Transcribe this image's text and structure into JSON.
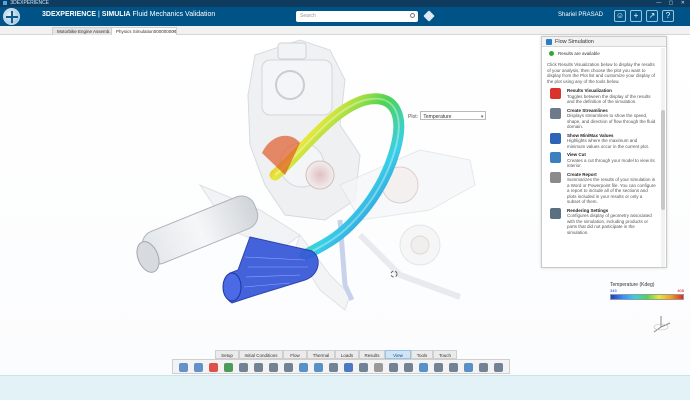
{
  "os_bar": {
    "title": "3DEXPERIENCE"
  },
  "header": {
    "brand": "3DEXPERIENCE",
    "separator": " | ",
    "app": "SIMULIA",
    "doc": " Fluid Mechanics Validation",
    "search_placeholder": "Search",
    "user_name": "Shariel PRASAD",
    "buttons": [
      "?",
      "+",
      "↗",
      "?"
    ]
  },
  "tabs": [
    {
      "label": "Motorbike Engine Assemb...",
      "active": false
    },
    {
      "label": "Physics Simulation000000004",
      "active": true
    }
  ],
  "viewport": {
    "plot_label": "Plot:",
    "plot_value": "Temperature"
  },
  "panel": {
    "title": "Flow Simulation",
    "status": "Results are available",
    "intro": "Click Results Visualization below to display the results of your analysis, then choose the plot you want to display from the Plot list and customize your display of the plot using any of the tools below.",
    "features": [
      {
        "title": "Results Visualization",
        "desc": "Toggles between the display of the results and the definition of the simulation.",
        "icon": "results-visualization-icon",
        "color": "#d9342b"
      },
      {
        "title": "Create Streamlines",
        "desc": "Displays streamlines to show the speed, shape, and direction of flow through the fluid domain.",
        "icon": "streamlines-icon",
        "color": "#6c7a89"
      },
      {
        "title": "Show Min/Max Values",
        "desc": "Highlights where the maximum and minimum values occur in the current plot.",
        "icon": "min-max-icon",
        "color": "#2d64b8"
      },
      {
        "title": "View Cut",
        "desc": "Creates a cut through your model to view its interior.",
        "icon": "view-cut-icon",
        "color": "#3b7fbf"
      },
      {
        "title": "Create Report",
        "desc": "Summarizes the results of your simulation in a Word or Powerpoint file. You can configure a report to include all of the sections and plots included in your results or only a subset of them.",
        "icon": "report-icon",
        "color": "#8a8a8a"
      },
      {
        "title": "Rendering Settings",
        "desc": "Configures display of geometry associated with the simulation, including products or parts that did not participate in the simulation.",
        "icon": "rendering-settings-icon",
        "color": "#5b6f82"
      }
    ]
  },
  "legend": {
    "title": "Temperature (Kdeg)",
    "min": "345",
    "max": "405",
    "colors": [
      "#1a3fcf",
      "#3b8cff",
      "#38d0e6",
      "#4fd44f",
      "#e8e83a",
      "#f29c2a",
      "#e42a1f"
    ]
  },
  "section_tabs": [
    "Setup",
    "Initial Conditions",
    "Flow",
    "Thermal",
    "Loads",
    "Results",
    "View",
    "Tools",
    "Touch"
  ],
  "active_section": "View",
  "toolbar": {
    "tools": [
      "undo-icon",
      "redo-icon",
      "compass-app-icon",
      "plot-icon",
      "zoom-icon",
      "fit-all-icon",
      "pan-icon",
      "rotate-icon",
      "look-at-icon",
      "normal-view-icon",
      "zoom-area-icon",
      "ground-icon",
      "shading-icon",
      "layers-icon",
      "multi-view-icon",
      "hide-show-icon",
      "cut-icon",
      "capture-icon",
      "measure-icon",
      "section-icon",
      "selection-icon",
      "properties-icon"
    ]
  }
}
